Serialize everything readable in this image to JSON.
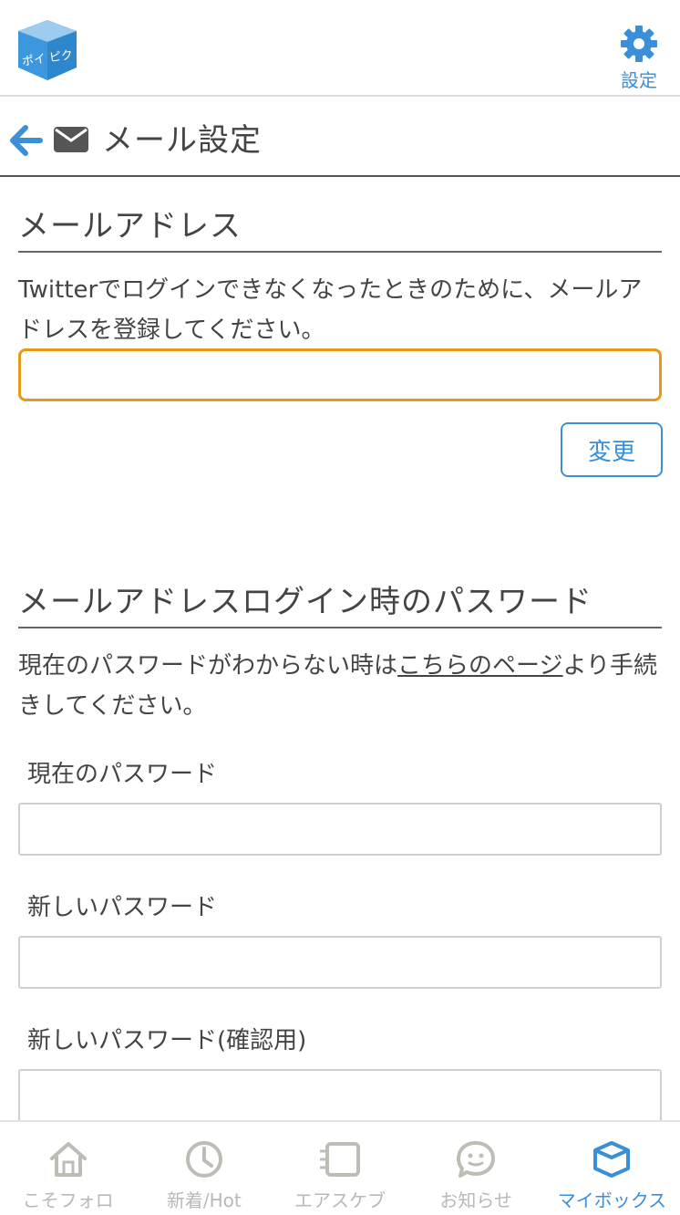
{
  "header": {
    "logo_text": "ポイピク",
    "settings_label": "設定"
  },
  "title_bar": {
    "title": "メール設定"
  },
  "email_section": {
    "title": "メールアドレス",
    "description": "Twitterでログインできなくなったときのために、メールアドレスを登録してください。",
    "input_value": "",
    "change_button": "変更"
  },
  "password_section": {
    "title": "メールアドレスログイン時のパスワード",
    "description_before": "現在のパスワードがわからない時は",
    "description_link": "こちらのページ",
    "description_after": "より手続きしてください。",
    "current_label": "現在のパスワード",
    "new_label": "新しいパスワード",
    "confirm_label": "新しいパスワード(確認用)"
  },
  "bottom_nav": {
    "items": [
      {
        "label": "こそフォロ",
        "icon": "home-icon"
      },
      {
        "label": "新着/Hot",
        "icon": "clock-icon"
      },
      {
        "label": "エアスケブ",
        "icon": "notebook-icon"
      },
      {
        "label": "お知らせ",
        "icon": "chat-icon"
      },
      {
        "label": "マイボックス",
        "icon": "box-icon",
        "active": true
      }
    ]
  },
  "colors": {
    "accent": "#3a8fd8",
    "focus_border": "#e69a1a",
    "inactive_nav": "#b9b9b9"
  }
}
